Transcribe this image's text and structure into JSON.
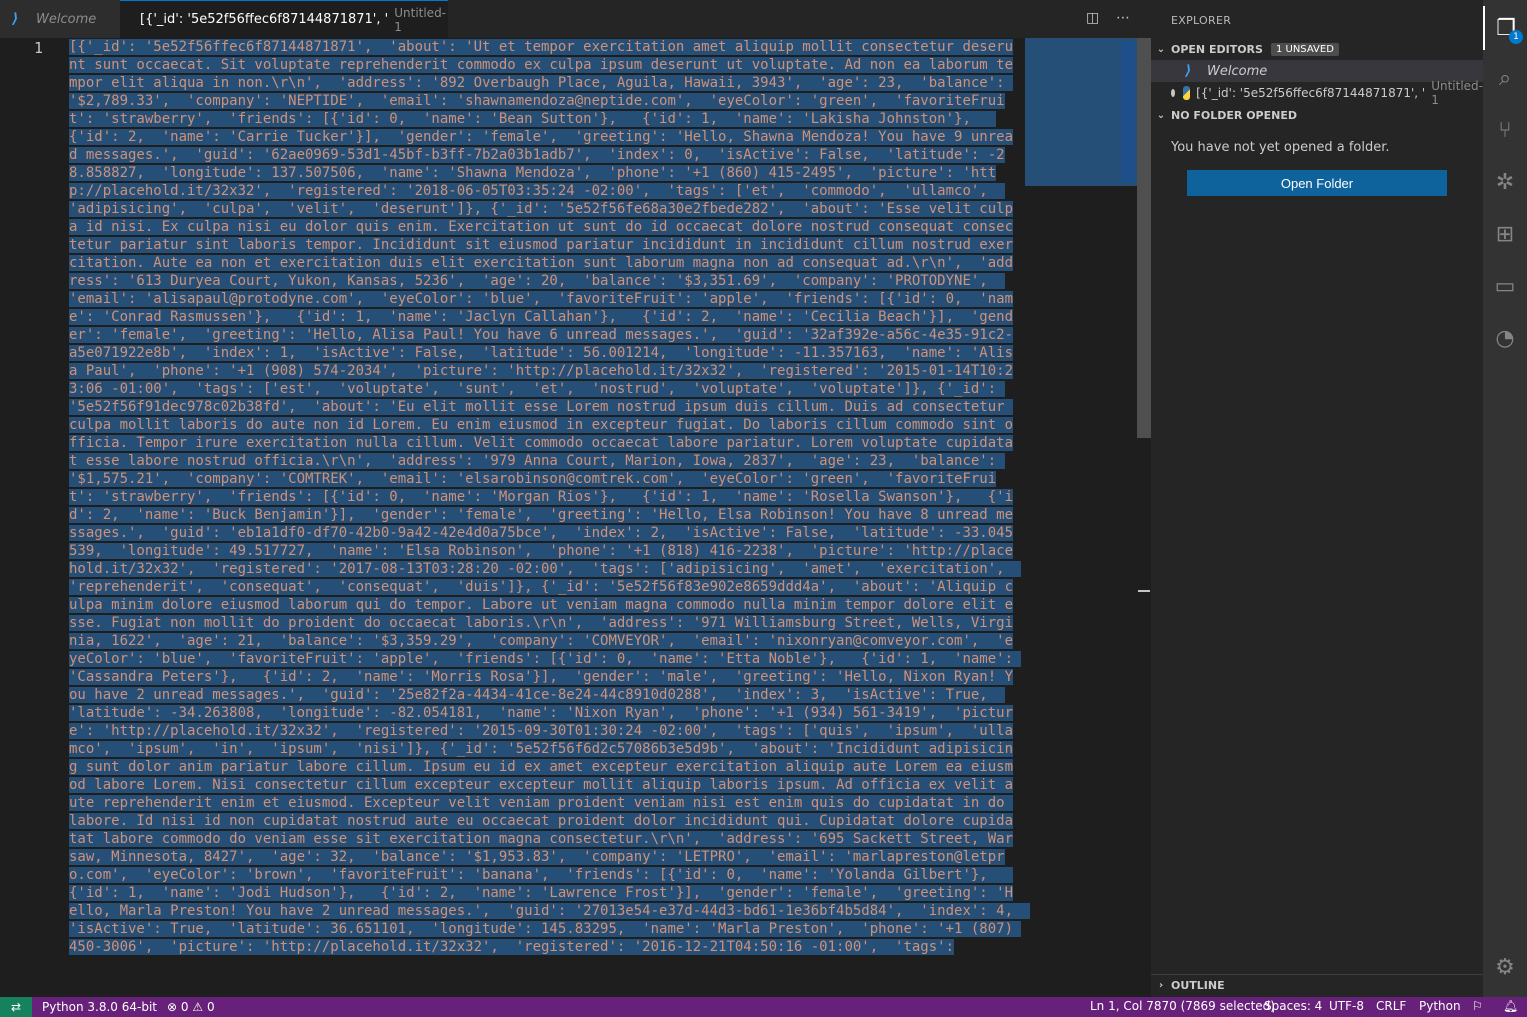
{
  "tabs": [
    {
      "label": "Welcome",
      "icon": "vscode-icon"
    },
    {
      "label": "[{'_id': '5e52f56ffec6f87144871871', '",
      "description": "Untitled-1",
      "icon": "python-icon",
      "dirty": true
    }
  ],
  "editor": {
    "line_number": "1",
    "code": "[{'_id': '5e52f56ffec6f87144871871',  'about': 'Ut et tempor exercitation amet aliquip mollit consectetur deserunt sunt occaecat. Sit voluptate reprehenderit commodo ex culpa ipsum deserunt ut voluptate. Ad non ea laborum tempor elit aliqua in non.\\r\\n',  'address': '892 Overbaugh Place, Aguila, Hawaii, 3943',  'age': 23,  'balance': '$2,789.33',  'company': 'NEPTIDE',  'email': 'shawnamendoza@neptide.com',  'eyeColor': 'green',  'favoriteFruit': 'strawberry',  'friends': [{'id': 0,  'name': 'Bean Sutton'},   {'id': 1,  'name': 'Lakisha Johnston'},   {'id': 2,  'name': 'Carrie Tucker'}],  'gender': 'female',  'greeting': 'Hello, Shawna Mendoza! You have 9 unread messages.',  'guid': '62ae0969-53d1-45bf-b3ff-7b2a03b1adb7',  'index': 0,  'isActive': False,  'latitude': -28.858827,  'longitude': 137.507506,  'name': 'Shawna Mendoza',  'phone': '+1 (860) 415-2495',  'picture': 'http://placehold.it/32x32',  'registered': '2018-06-05T03:35:24 -02:00',  'tags': ['et',  'commodo',  'ullamco',  'adipisicing',  'culpa',  'velit',  'deserunt']}, {'_id': '5e52f56fe68a30e2fbede282',  'about': 'Esse velit culpa id nisi. Ex culpa nisi eu dolor quis enim. Exercitation ut sunt do id occaecat dolore nostrud consequat consectetur pariatur sint laboris tempor. Incididunt sit eiusmod pariatur incididunt in incididunt cillum nostrud exercitation. Aute ea non et exercitation duis elit exercitation sunt laborum magna non ad consequat ad.\\r\\n',  'address': '613 Duryea Court, Yukon, Kansas, 5236',  'age': 20,  'balance': '$3,351.69',  'company': 'PROTODYNE',  'email': 'alisapaul@protodyne.com',  'eyeColor': 'blue',  'favoriteFruit': 'apple',  'friends': [{'id': 0,  'name': 'Conrad Rasmussen'},   {'id': 1,  'name': 'Jaclyn Callahan'},   {'id': 2,  'name': 'Cecilia Beach'}],  'gender': 'female',  'greeting': 'Hello, Alisa Paul! You have 6 unread messages.',  'guid': '32af392e-a56c-4e35-91c2-a5e071922e8b',  'index': 1,  'isActive': False,  'latitude': 56.001214,  'longitude': -11.357163,  'name': 'Alisa Paul',  'phone': '+1 (908) 574-2034',  'picture': 'http://placehold.it/32x32',  'registered': '2015-01-14T10:23:06 -01:00',  'tags': ['est',  'voluptate',  'sunt',  'et',  'nostrud',  'voluptate',  'voluptate']}, {'_id': '5e52f56f91dec978c02b38fd',  'about': 'Eu elit mollit esse Lorem nostrud ipsum duis cillum. Duis ad consectetur culpa mollit laboris do aute non id Lorem. Eu enim eiusmod in excepteur fugiat. Do laboris cillum commodo sint officia. Tempor irure exercitation nulla cillum. Velit commodo occaecat labore pariatur. Lorem voluptate cupidatat esse labore nostrud officia.\\r\\n',  'address': '979 Anna Court, Marion, Iowa, 2837',  'age': 23,  'balance': '$1,575.21',  'company': 'COMTREK',  'email': 'elsarobinson@comtrek.com',  'eyeColor': 'green',  'favoriteFruit': 'strawberry',  'friends': [{'id': 0,  'name': 'Morgan Rios'},   {'id': 1,  'name': 'Rosella Swanson'},   {'id': 2,  'name': 'Buck Benjamin'}],  'gender': 'female',  'greeting': 'Hello, Elsa Robinson! You have 8 unread messages.',  'guid': 'eb1a1df0-df70-42b0-9a42-42e4d0a75bce',  'index': 2,  'isActive': False,  'latitude': -33.045539,  'longitude': 49.517727,  'name': 'Elsa Robinson',  'phone': '+1 (818) 416-2238',  'picture': 'http://placehold.it/32x32',  'registered': '2017-08-13T03:28:20 -02:00',  'tags': ['adipisicing',  'amet',  'exercitation',  'reprehenderit',  'consequat',  'consequat',  'duis']}, {'_id': '5e52f56f83e902e8659ddd4a',  'about': 'Aliquip culpa minim dolore eiusmod laborum qui do tempor. Labore ut veniam magna commodo nulla minim tempor dolore elit esse. Fugiat non mollit do proident do occaecat laboris.\\r\\n',  'address': '971 Williamsburg Street, Wells, Virginia, 1622',  'age': 21,  'balance': '$3,359.29',  'company': 'COMVEYOR',  'email': 'nixonryan@comveyor.com',  'eyeColor': 'blue',  'favoriteFruit': 'apple',  'friends': [{'id': 0,  'name': 'Etta Noble'},   {'id': 1,  'name': 'Cassandra Peters'},   {'id': 2,  'name': 'Morris Rosa'}],  'gender': 'male',  'greeting': 'Hello, Nixon Ryan! You have 2 unread messages.',  'guid': '25e82f2a-4434-41ce-8e24-44c8910d0288',  'index': 3,  'isActive': True,  'latitude': -34.263808,  'longitude': -82.054181,  'name': 'Nixon Ryan',  'phone': '+1 (934) 561-3419',  'picture': 'http://placehold.it/32x32',  'registered': '2015-09-30T01:30:24 -02:00',  'tags': ['quis',  'ipsum',  'ullamco',  'ipsum',  'in',  'ipsum',  'nisi']}, {'_id': '5e52f56f6d2c57086b3e5d9b',  'about': 'Incididunt adipisicing sunt dolor anim pariatur labore cillum. Ipsum eu id ex amet excepteur exercitation aliquip aute Lorem ea eiusmod labore Lorem. Nisi consectetur cillum excepteur excepteur mollit aliquip laboris ipsum. Ad officia ex velit aute reprehenderit enim et eiusmod. Excepteur velit veniam proident veniam nisi est enim quis do cupidatat in do labore. Id nisi id non cupidatat nostrud aute eu occaecat proident dolor incididunt qui. Cupidatat dolore cupidatat labore commodo do veniam esse sit exercitation magna consectetur.\\r\\n',  'address': '695 Sackett Street, Warsaw, Minnesota, 8427',  'age': 32,  'balance': '$1,953.83',  'company': 'LETPRO',  'email': 'marlapreston@letpro.com',  'eyeColor': 'brown',  'favoriteFruit': 'banana',  'friends': [{'id': 0,  'name': 'Yolanda Gilbert'},   {'id': 1,  'name': 'Jodi Hudson'},   {'id': 2,  'name': 'Lawrence Frost'}],  'gender': 'female',  'greeting': 'Hello, Marla Preston! You have 2 unread messages.',  'guid': '27013e54-e37d-44d3-bd61-1e36bf4b5d84',  'index': 4,  'isActive': True,  'latitude': 36.651101,  'longitude': 145.83295,  'name': 'Marla Preston',  'phone': '+1 (807) 450-3006',  'picture': 'http://placehold.it/32x32',  'registered': '2016-12-21T04:50:16 -01:00',  'tags':"
  },
  "explorer": {
    "title": "EXPLORER",
    "open_editors_label": "OPEN EDITORS",
    "unsaved_badge": "1 UNSAVED",
    "open_editors": [
      {
        "label": "Welcome"
      },
      {
        "label": "[{'_id': '5e52f56ffec6f87144871871', '",
        "description": "Untitled-1"
      }
    ],
    "no_folder_label": "NO FOLDER OPENED",
    "no_folder_text": "You have not yet opened a folder.",
    "open_folder_button": "Open Folder",
    "outline_label": "OUTLINE"
  },
  "activity_bar": {
    "items": [
      "explorer-icon",
      "search-icon",
      "source-control-icon",
      "debug-icon",
      "extensions-icon",
      "remote-explorer-icon",
      "git-graph-icon"
    ],
    "explorer_badge": "1",
    "settings": "gear-icon"
  },
  "status_bar": {
    "interpreter": "Python 3.8.0 64-bit",
    "errors": "0",
    "warnings": "0",
    "cursor": "Ln 1, Col 7870 (7869 selected)",
    "indent": "Spaces: 4",
    "encoding": "UTF-8",
    "eol": "CRLF",
    "language": "Python"
  },
  "colors": {
    "accent": "#007acc",
    "status_bar": "#68217a",
    "selection": "#264f78",
    "string": "#ce9178"
  }
}
